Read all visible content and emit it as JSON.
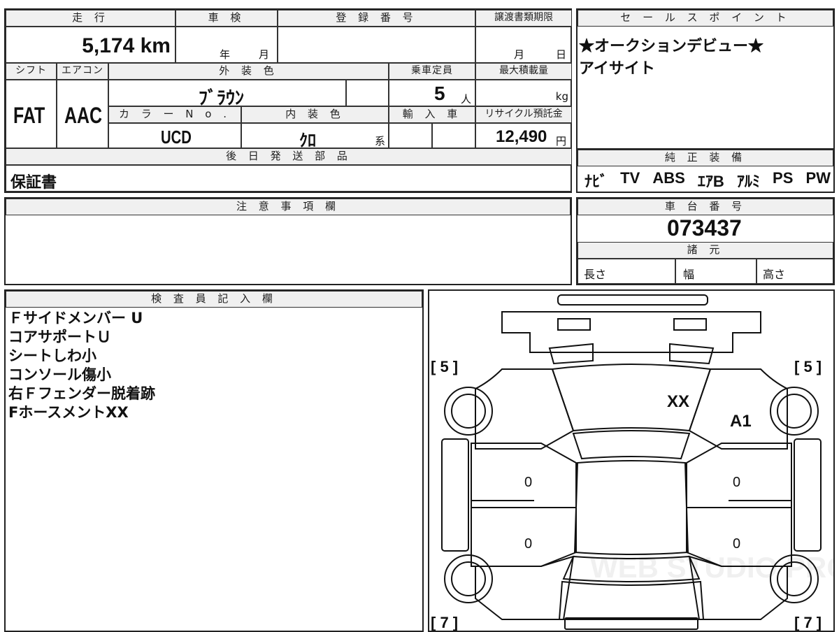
{
  "top_left": {
    "headers": {
      "mileage": "走 行",
      "inspection": "車 検",
      "registration": "登 録 番 号",
      "transfer_deadline": "譲渡書類期限",
      "shift": "シフト",
      "aircon": "エアコン",
      "exterior_color": "外 装 色",
      "capacity": "乗車定員",
      "max_load": "最大積載量",
      "color_no": "カ ラ ー N o .",
      "interior_color": "内 装 色",
      "import": "輸 入 車",
      "recycle": "リサイクル預託金",
      "later_parts": "後 日 発 送 部 品"
    },
    "mileage_value": "5,174 km",
    "inspection_year_unit": "年",
    "inspection_month_unit": "月",
    "deadline_month_unit": "月",
    "deadline_day_unit": "日",
    "shift_value": "FAT",
    "aircon_value": "AAC",
    "exterior_color_value": "ﾌﾞﾗｳﾝ",
    "capacity_value": "5",
    "capacity_unit": "人",
    "max_load_unit": "kg",
    "color_no_value": "UCD",
    "interior_color_value": "ｸﾛ",
    "interior_color_suffix": "系",
    "recycle_value": "12,490",
    "recycle_unit": "円",
    "later_parts_value": "保証書"
  },
  "sales_points": {
    "header": "セ ー ル ス ポ イ ン ト",
    "lines": [
      "★オークションデビュー★",
      "アイサイト"
    ]
  },
  "equipment": {
    "header": "純 正 装 備",
    "items": [
      "ﾅﾋﾞ",
      "TV",
      "ABS",
      "ｴｱB",
      "ｱﾙﾐ",
      "PS",
      "PW"
    ]
  },
  "notes": {
    "header": "注 意 事 項 欄",
    "body": ""
  },
  "chassis": {
    "header": "車 台 番 号",
    "value": "073437"
  },
  "specs": {
    "header": "諸 元",
    "length": "長さ",
    "width": "幅",
    "height": "高さ"
  },
  "inspector": {
    "header": "検 査 員 記 入 欄",
    "lines": [
      "Ｆサイドメンバー U",
      "コアサポートＵ",
      "シートしわ小",
      "コンソール傷小",
      "右Ｆフェンダー脱着跡",
      "FホースメントXX"
    ]
  },
  "diagram": {
    "tire_front_left": "[ 5 ]",
    "tire_front_right": "[ 5 ]",
    "tire_rear_left": "[ 7 ]",
    "tire_rear_right": "[ 7 ]",
    "mark_hood": "XX",
    "mark_fender": "A1",
    "door_marks": [
      "0",
      "0",
      "0",
      "0"
    ],
    "watermark": "WEB STUDIO PRO"
  }
}
